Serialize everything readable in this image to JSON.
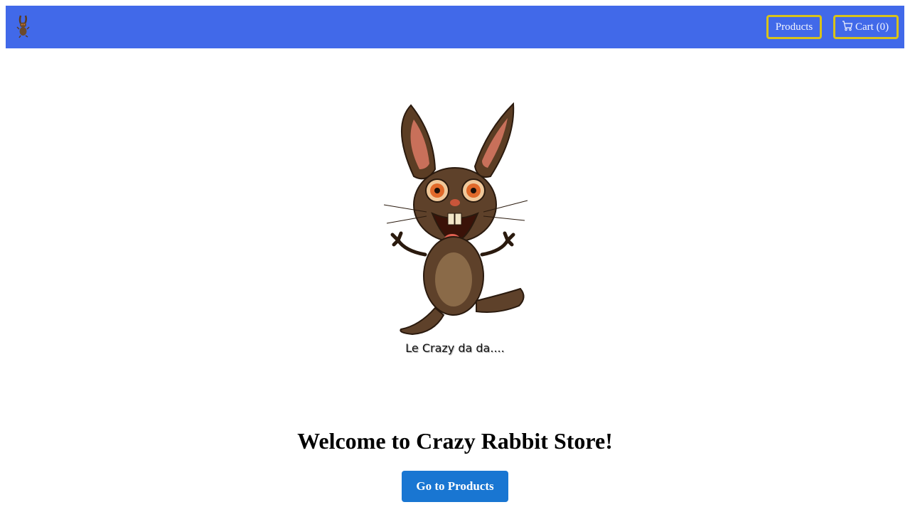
{
  "header": {
    "logo_icon": "rabbit-logo-icon",
    "nav": {
      "products_label": "Products",
      "cart_label": "Cart (0)",
      "cart_icon": "shopping-cart-icon"
    },
    "accent_color": "#4169e9",
    "button_border_color": "#d8c21a"
  },
  "hero": {
    "image_icon": "crazy-rabbit-illustration",
    "caption": "Le Crazy da da...."
  },
  "main": {
    "welcome_title": "Welcome to Crazy Rabbit Store!",
    "cta_label": "Go to Products",
    "cta_color": "#1976d2"
  }
}
